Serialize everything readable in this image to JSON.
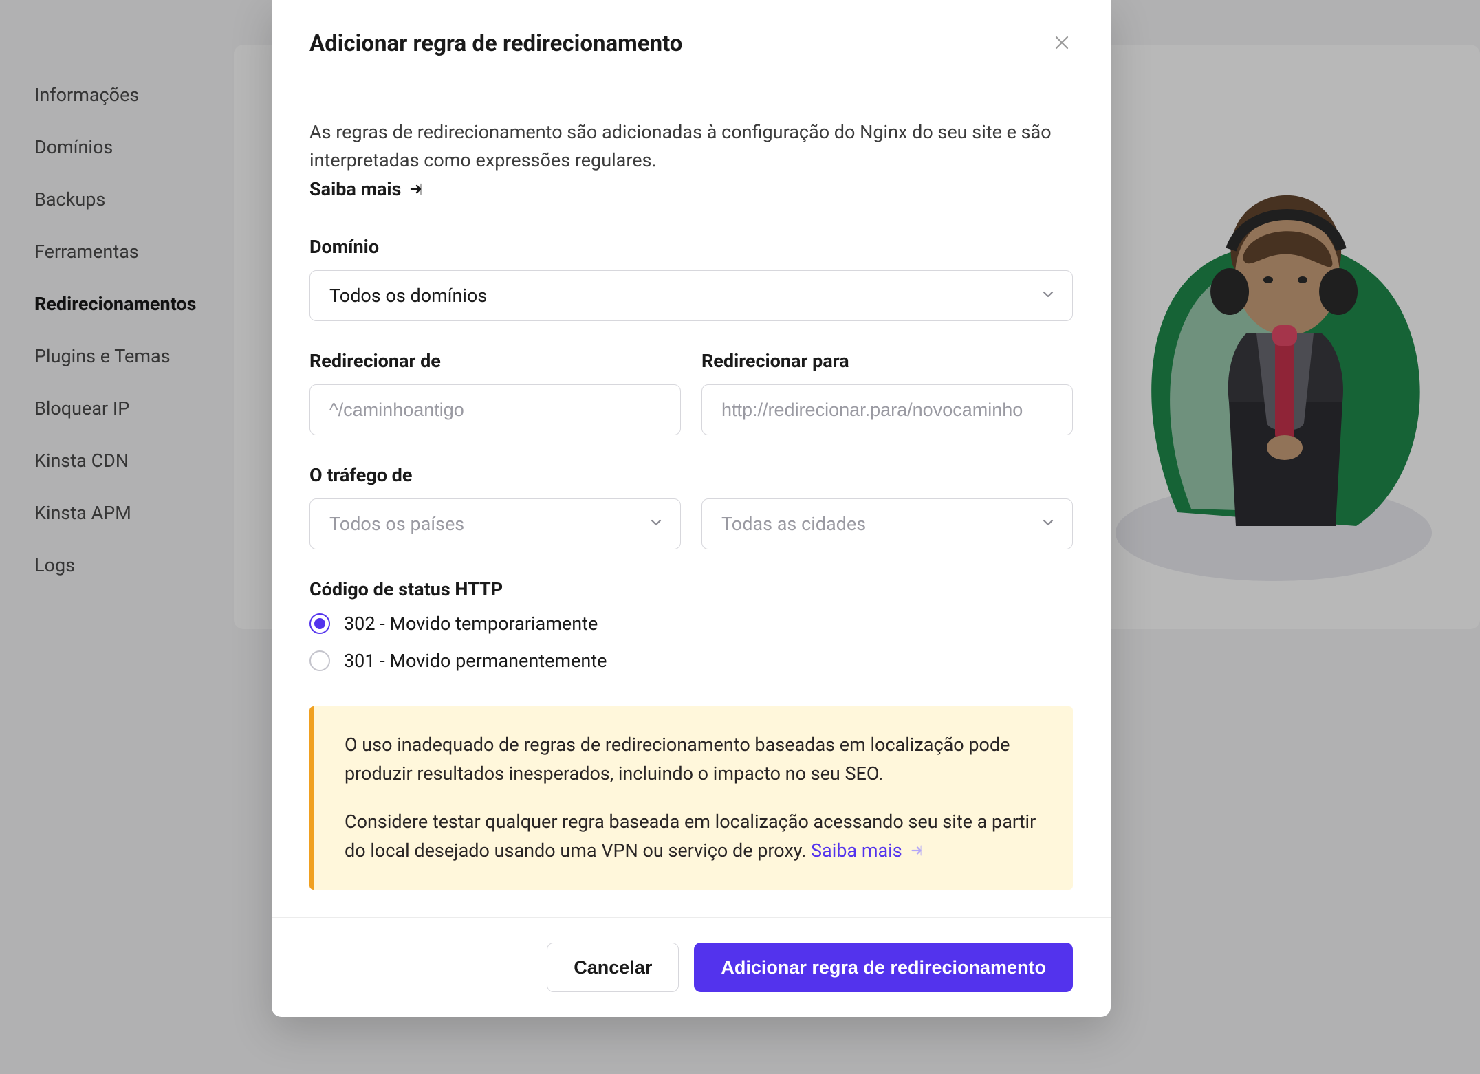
{
  "sidebar": {
    "items": [
      {
        "label": "Informações",
        "active": false
      },
      {
        "label": "Domínios",
        "active": false
      },
      {
        "label": "Backups",
        "active": false
      },
      {
        "label": "Ferramentas",
        "active": false
      },
      {
        "label": "Redirecionamentos",
        "active": true
      },
      {
        "label": "Plugins e Temas",
        "active": false
      },
      {
        "label": "Bloquear IP",
        "active": false
      },
      {
        "label": "Kinsta CDN",
        "active": false
      },
      {
        "label": "Kinsta APM",
        "active": false
      },
      {
        "label": "Logs",
        "active": false
      }
    ]
  },
  "modal": {
    "title": "Adicionar regra de redirecionamento",
    "intro": "As regras de redirecionamento são adicionadas à configuração do Nginx do seu site e são interpretadas como expressões regulares.",
    "learn_more": "Saiba mais",
    "fields": {
      "domain_label": "Domínio",
      "domain_value": "Todos os domínios",
      "redirect_from_label": "Redirecionar de",
      "redirect_from_placeholder": "^/caminhoantigo",
      "redirect_to_label": "Redirecionar para",
      "redirect_to_placeholder": "http://redirecionar.para/novocaminho",
      "traffic_from_label": "O tráfego de",
      "countries_placeholder": "Todos os países",
      "cities_placeholder": "Todas as cidades",
      "http_status_label": "Código de status HTTP",
      "status_302": "302 - Movido temporariamente",
      "status_301": "301 - Movido permanentemente"
    },
    "warning": {
      "p1": "O uso inadequado de regras de redirecionamento baseadas em localização pode produzir resultados inesperados, incluindo o impacto no seu SEO.",
      "p2_a": "Considere testar qualquer regra baseada em localização acessando seu site a partir do local desejado usando uma VPN ou serviço de proxy. ",
      "p2_link": "Saiba mais"
    },
    "buttons": {
      "cancel": "Cancelar",
      "submit": "Adicionar regra de redirecionamento"
    }
  }
}
